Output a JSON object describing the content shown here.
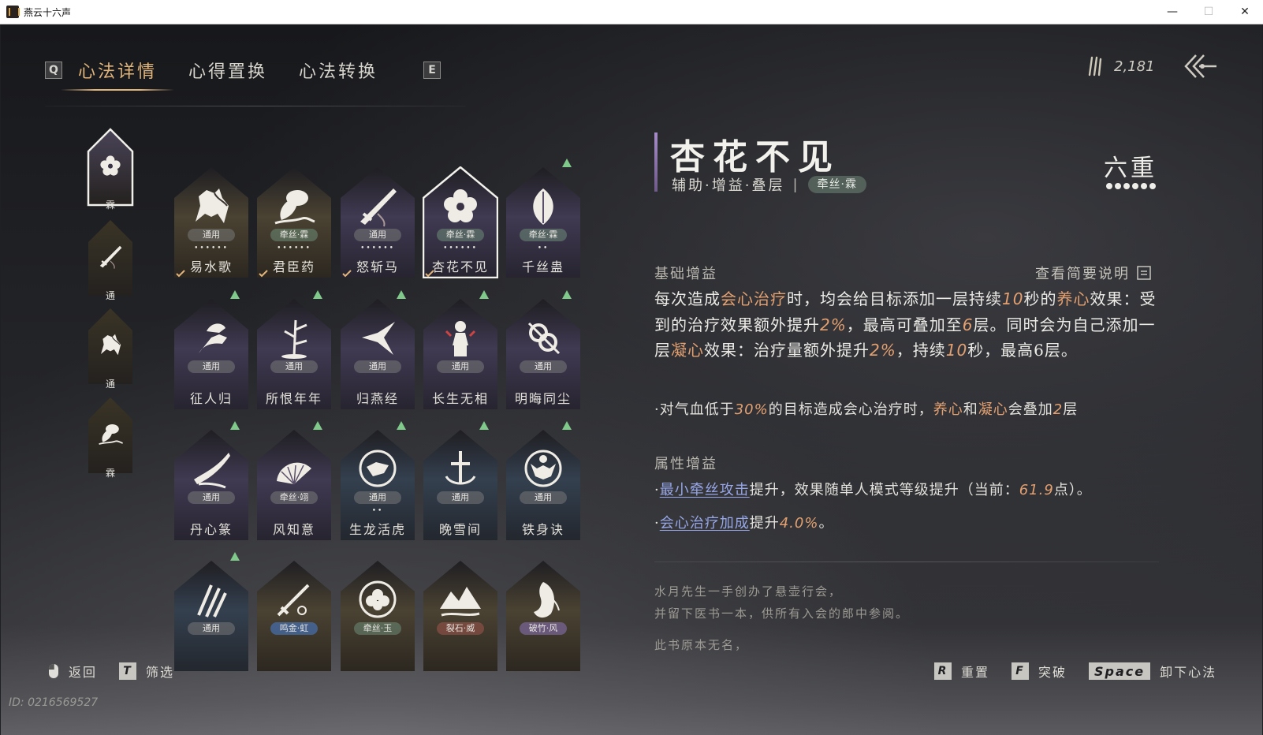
{
  "window": {
    "title": "燕云十六声",
    "minimize": "—",
    "maximize": "☐",
    "close": "✕"
  },
  "tabs": {
    "left_key": "Q",
    "right_key": "E",
    "items": [
      {
        "label": "心法详情",
        "active": true
      },
      {
        "label": "心得置换",
        "active": false
      },
      {
        "label": "心法转换",
        "active": false
      }
    ]
  },
  "currency": {
    "icon": "feather-currency-icon",
    "value": "2,181"
  },
  "equipped": [
    {
      "badge": "霖",
      "icon": "flower-icon",
      "selected": true
    },
    {
      "badge": "通",
      "icon": "blade-icon",
      "selected": false
    },
    {
      "badge": "通",
      "icon": "horse-icon",
      "selected": false
    },
    {
      "badge": "霖",
      "icon": "water-jar-icon",
      "selected": false
    }
  ],
  "cards": [
    {
      "name": "易水歌",
      "tag": "通用",
      "tag_style": "gray",
      "dots": "••••••",
      "icon": "horse-icon",
      "tone": "gold",
      "checked": true,
      "upgrade": false,
      "selected": false
    },
    {
      "name": "君臣药",
      "tag": "牵丝·霖",
      "tag_style": "jade",
      "dots": "••••••",
      "icon": "water-jar-icon",
      "tone": "gold",
      "checked": true,
      "upgrade": false,
      "selected": false
    },
    {
      "name": "怒斩马",
      "tag": "通用",
      "tag_style": "gray",
      "dots": "••••••",
      "icon": "blade-icon",
      "tone": "purple",
      "checked": true,
      "upgrade": false,
      "selected": false
    },
    {
      "name": "杏花不见",
      "tag": "牵丝·霖",
      "tag_style": "jade",
      "dots": "••••••",
      "icon": "flower-icon",
      "tone": "purple",
      "checked": true,
      "upgrade": false,
      "selected": true
    },
    {
      "name": "千丝蛊",
      "tag": "牵丝·霖",
      "tag_style": "jade",
      "dots": "••",
      "icon": "seed-icon",
      "tone": "purple",
      "checked": false,
      "upgrade": true,
      "selected": false
    },
    {
      "name": "征人归",
      "tag": "通用",
      "tag_style": "gray",
      "dots": "",
      "icon": "bird-hand-icon",
      "tone": "purple",
      "checked": false,
      "upgrade": true,
      "selected": false
    },
    {
      "name": "所恨年年",
      "tag": "通用",
      "tag_style": "gray",
      "dots": "",
      "icon": "bamboo-icon",
      "tone": "purple",
      "checked": false,
      "upgrade": true,
      "selected": false
    },
    {
      "name": "归燕经",
      "tag": "通用",
      "tag_style": "gray",
      "dots": "",
      "icon": "swallow-icon",
      "tone": "purple",
      "checked": false,
      "upgrade": true,
      "selected": false
    },
    {
      "name": "长生无相",
      "tag": "通用",
      "tag_style": "gray",
      "dots": "",
      "icon": "statue-icon",
      "tone": "purple",
      "checked": false,
      "upgrade": true,
      "selected": false
    },
    {
      "name": "明晦同尘",
      "tag": "通用",
      "tag_style": "gray",
      "dots": "",
      "icon": "knot-icon",
      "tone": "purple",
      "checked": false,
      "upgrade": true,
      "selected": false
    },
    {
      "name": "丹心篆",
      "tag": "通用",
      "tag_style": "gray",
      "dots": "",
      "icon": "brush-icon",
      "tone": "purple",
      "checked": false,
      "upgrade": true,
      "selected": false
    },
    {
      "name": "风知意",
      "tag": "牵丝·翊",
      "tag_style": "gray",
      "dots": "",
      "icon": "fan-icon",
      "tone": "purple",
      "checked": false,
      "upgrade": true,
      "selected": false
    },
    {
      "name": "生龙活虎",
      "tag": "通用",
      "tag_style": "gray",
      "dots": "••",
      "icon": "tiger-icon",
      "tone": "blue",
      "checked": false,
      "upgrade": true,
      "selected": false
    },
    {
      "name": "晚雪间",
      "tag": "通用",
      "tag_style": "gray",
      "dots": "",
      "icon": "cross-anchor-icon",
      "tone": "blue",
      "checked": false,
      "upgrade": true,
      "selected": false
    },
    {
      "name": "铁身诀",
      "tag": "通用",
      "tag_style": "gray",
      "dots": "",
      "icon": "strongman-icon",
      "tone": "blue",
      "checked": false,
      "upgrade": true,
      "selected": false
    },
    {
      "name": "",
      "tag": "通用",
      "tag_style": "gray",
      "dots": "",
      "icon": "claw-icon",
      "tone": "blue",
      "checked": false,
      "upgrade": true,
      "selected": false
    },
    {
      "name": "",
      "tag": "鸣金·虹",
      "tag_style": "blue",
      "dots": "",
      "icon": "sword-icon",
      "tone": "gold",
      "checked": false,
      "upgrade": false,
      "selected": false
    },
    {
      "name": "",
      "tag": "牵丝·玉",
      "tag_style": "jade",
      "dots": "",
      "icon": "peony-icon",
      "tone": "gold",
      "checked": false,
      "upgrade": false,
      "selected": false
    },
    {
      "name": "",
      "tag": "裂石·威",
      "tag_style": "red",
      "dots": "",
      "icon": "mountain-icon",
      "tone": "gold",
      "checked": false,
      "upgrade": false,
      "selected": false
    },
    {
      "name": "",
      "tag": "破竹·风",
      "tag_style": "purple",
      "dots": "",
      "icon": "wind-face-icon",
      "tone": "gold",
      "checked": false,
      "upgrade": false,
      "selected": false
    }
  ],
  "detail": {
    "title": "杏花不见",
    "subtitle": "辅助·增益·叠层",
    "separator": "|",
    "school": "牵丝·霖",
    "tier": "六重",
    "tier_level": 6,
    "base_head": "基础增益",
    "view_desc": "查看简要说明",
    "para": {
      "p1": "每次造成",
      "h1": "会心治疗",
      "p2": "时，均会给目标添加一层持续",
      "n1": "10",
      "p3": "秒的",
      "h2": "养心",
      "p4": "效果：受到的治疗效果额外提升",
      "n2": "2%",
      "p5": "，最高可叠加至",
      "n3": "6",
      "p6": "层。同时会为自己添加一层",
      "h3": "凝心",
      "p7": "效果：治疗量额外提升",
      "n4": "2%",
      "p8": "，持续",
      "n5": "10",
      "p9": "秒，最高6层。"
    },
    "bullet": {
      "b1": "·对气血低于",
      "n1": "30%",
      "b2": "的目标造成会心治疗时，",
      "h1": "养心",
      "b3": "和",
      "h2": "凝心",
      "b4": "会叠加",
      "n2": "2",
      "b5": "层"
    },
    "attr_head": "属性增益",
    "attr1": {
      "dot": "·",
      "link": "最小牵丝攻击",
      "text": "提升，效果随单人模式等级提升（当前：",
      "num": "61.9",
      "tail": "点）。"
    },
    "attr2": {
      "dot": "·",
      "link": "会心治疗加成",
      "text": "提升",
      "num": "4.0%",
      "tail": "。"
    },
    "lore": [
      "水月先生一手创办了悬壶行会，",
      "并留下医书一本，供所有入会的郎中参阅。",
      "此书原本无名，"
    ]
  },
  "hints": {
    "back": "返回",
    "filter_key": "T",
    "filter": "筛选",
    "reset_key": "R",
    "reset": "重置",
    "break_key": "F",
    "break": "突破",
    "unequip_key": "Space",
    "unequip": "卸下心法"
  },
  "uid": "ID: 0216569527",
  "colors": {
    "accent_gold": "#e2b57b",
    "highlight_orange": "#e3a070",
    "link_blue": "#97a6e6",
    "upgrade_green": "#7fc98a"
  }
}
